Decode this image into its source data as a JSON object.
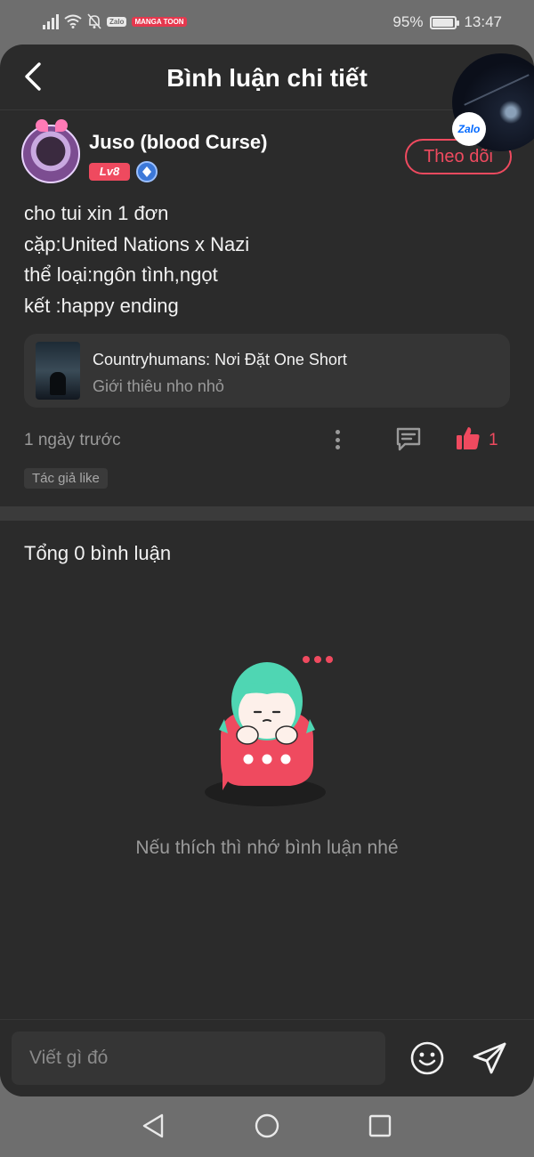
{
  "status_bar": {
    "badge_zalo": "Zalo",
    "badge_manga": "MANGA TOON",
    "battery": "95%",
    "battery_level": 0.95,
    "time": "13:47"
  },
  "header": {
    "title": "Bình luận chi tiết",
    "floating_badge": "Zalo"
  },
  "post": {
    "author": "Juso (blood Curse)",
    "level": "Lv8",
    "follow_label": "Theo dõi",
    "body_lines": [
      "cho tui xin 1 đơn",
      "cặp:United Nations x Nazi",
      "thể loại:ngôn tình,ngọt",
      "kết :happy ending"
    ],
    "story": {
      "title": "Countryhumans: Nơi Đặt One Short",
      "description": "Giới thiêu nho nhỏ"
    },
    "timestamp": "1 ngày trước",
    "like_count": "1",
    "author_like_tag": "Tác giả like"
  },
  "comments": {
    "total": "Tổng 0 bình luận",
    "empty_message": "Nếu thích thì nhớ bình luận nhé"
  },
  "input": {
    "placeholder": "Viết gì đó"
  },
  "colors": {
    "accent": "#ef4a5f",
    "background": "#2b2b2b",
    "surface": "#353535",
    "text_secondary": "#9a9a9a",
    "system_bar": "#6e6e6e"
  },
  "icons": {
    "back": "chevron-left-icon",
    "verified": "diamond-badge-icon",
    "more": "more-vertical-icon",
    "reply": "comment-icon",
    "like": "thumbs-up-icon",
    "emoji": "smiley-icon",
    "send": "send-icon"
  }
}
